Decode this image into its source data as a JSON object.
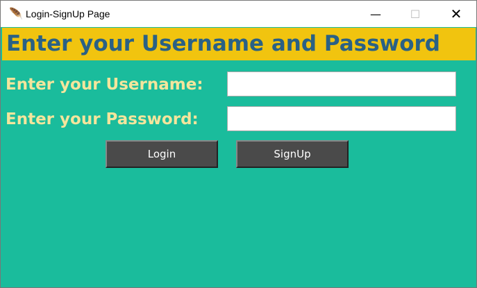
{
  "window": {
    "title": "Login-SignUp Page",
    "app_icon": "feather-icon",
    "controls": [
      "minimize-icon",
      "maximize-icon",
      "close-icon"
    ]
  },
  "header": {
    "text": "Enter your Username and Password"
  },
  "form": {
    "username_label": "Enter your Username:",
    "username_value": "",
    "password_label": "Enter your Password:",
    "password_value": ""
  },
  "buttons": {
    "login": "Login",
    "signup": "SignUp"
  },
  "colors": {
    "background": "#1abc9c",
    "header_bg": "#f1c40f",
    "header_text": "#2a6185",
    "label_text": "#f4e59c",
    "button_bg": "#4a4a4a"
  }
}
